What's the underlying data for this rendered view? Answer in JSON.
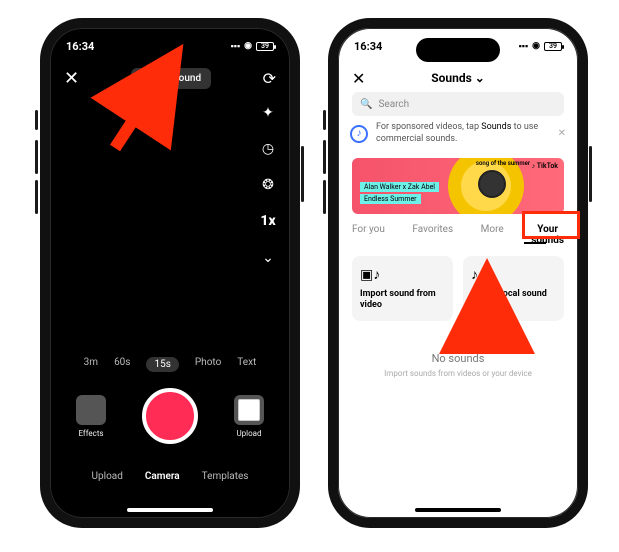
{
  "status": {
    "time": "16:34",
    "battery": "39"
  },
  "camera": {
    "add_sound": "Add sound",
    "durations": [
      "3m",
      "60s",
      "15s",
      "Photo",
      "Text"
    ],
    "duration_active": 2,
    "effects_label": "Effects",
    "upload_label": "Upload",
    "modes": [
      "Upload",
      "Camera",
      "Templates"
    ],
    "mode_active": 1
  },
  "sounds": {
    "title": "Sounds",
    "search_placeholder": "Search",
    "notice_pre": "For sponsored videos, tap ",
    "notice_bold": "Sounds",
    "notice_post": " to use commercial sounds.",
    "banner_brand": "TikTok",
    "banner_tag1": "Alan Walker x Zak Abel",
    "banner_tag2": "Endless Summer",
    "banner_curve": "song of the summer",
    "tabs": {
      "foryou": "For you",
      "favorites": "Favorites",
      "more": "More",
      "yoursounds_l1": "Your",
      "yoursounds_l2": "sounds"
    },
    "import_video": "Import sound from video",
    "import_local": "Import local sound",
    "empty_title": "No sounds",
    "empty_sub": "Import sounds from videos or your device"
  }
}
